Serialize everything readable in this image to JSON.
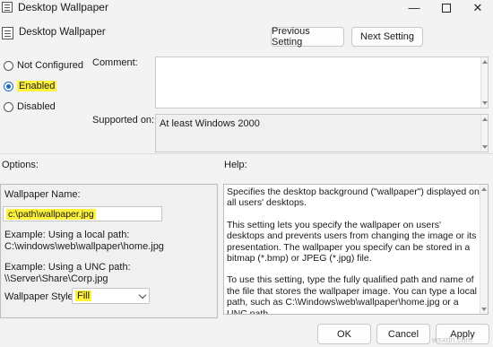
{
  "window": {
    "title": "Desktop Wallpaper",
    "minimize": "—",
    "close": "✕"
  },
  "header": {
    "policy_name": "Desktop Wallpaper",
    "previous_label": "Previous Setting",
    "next_label": "Next Setting"
  },
  "state": {
    "options": [
      {
        "label": "Not Configured",
        "selected": false
      },
      {
        "label": "Enabled",
        "selected": true
      },
      {
        "label": "Disabled",
        "selected": false
      }
    ]
  },
  "comment": {
    "label": "Comment:",
    "value": ""
  },
  "supported": {
    "label": "Supported on:",
    "value": "At least Windows 2000"
  },
  "options": {
    "heading": "Options:",
    "wallpaper_name_label": "Wallpaper Name:",
    "wallpaper_name_value": "c:\\path\\wallpaper.jpg",
    "local_example_label": "Example: Using a local path:",
    "local_example_path": "C:\\windows\\web\\wallpaper\\home.jpg",
    "unc_example_label": "Example: Using a UNC path:",
    "unc_example_path": "\\\\Server\\Share\\Corp.jpg",
    "style_label": "Wallpaper Style:",
    "style_value": "Fill"
  },
  "help": {
    "heading": "Help:",
    "paragraphs": [
      "Specifies the desktop background (\"wallpaper\") displayed on all users' desktops.",
      "This setting lets you specify the wallpaper on users' desktops and prevents users from changing the image or its presentation. The wallpaper you specify can be stored in a bitmap (*.bmp) or JPEG (*.jpg) file.",
      "To use this setting, type the fully qualified path and name of the file that stores the wallpaper image. You can type a local path, such as C:\\Windows\\web\\wallpaper\\home.jpg or a UNC path,"
    ]
  },
  "footer": {
    "ok_label": "OK",
    "cancel_label": "Cancel",
    "apply_label": "Apply"
  },
  "watermark": "wsxdn.com",
  "colors": {
    "highlight": "#fff23a",
    "radio_selected": "#1a6ac4"
  }
}
